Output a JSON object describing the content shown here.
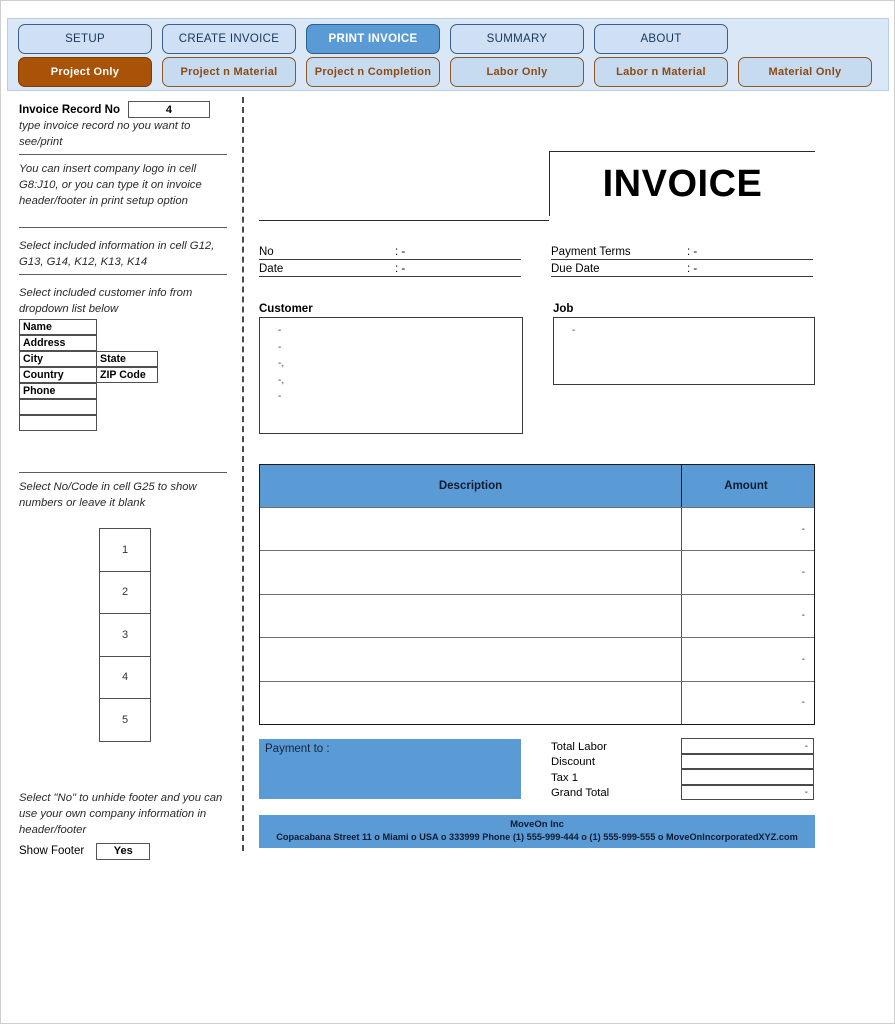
{
  "tabs": {
    "main": [
      {
        "label": "SETUP",
        "active": false
      },
      {
        "label": "CREATE INVOICE",
        "active": false
      },
      {
        "label": "PRINT INVOICE",
        "active": true
      },
      {
        "label": "SUMMARY",
        "active": false
      },
      {
        "label": "ABOUT",
        "active": false
      }
    ],
    "sub": [
      {
        "label": "Project Only",
        "active": true
      },
      {
        "label": "Project n Material",
        "active": false
      },
      {
        "label": "Project n Completion",
        "active": false
      },
      {
        "label": "Labor Only",
        "active": false
      },
      {
        "label": "Labor n Material",
        "active": false
      },
      {
        "label": "Material Only",
        "active": false
      }
    ]
  },
  "sidebar": {
    "record_label": "Invoice Record No",
    "record_value": "4",
    "hint_record": "type invoice record no you want to see/print",
    "hint_logo": "You can insert company logo in cell G8:J10, or you can type it on invoice header/footer in print setup option",
    "hint_info": "Select included information in cell G12, G13, G14, K12, K13, K14",
    "hint_customer": "Select included customer info from dropdown list below",
    "customer_fields": [
      {
        "left": "Name",
        "right": ""
      },
      {
        "left": "Address",
        "right": ""
      },
      {
        "left": "City",
        "right": "State"
      },
      {
        "left": "Country",
        "right": "ZIP Code"
      },
      {
        "left": "Phone",
        "right": ""
      },
      {
        "left": "",
        "right": ""
      },
      {
        "left": "",
        "right": ""
      }
    ],
    "hint_nocode": "Select No/Code in cell G25 to show numbers or leave it blank",
    "numbers": [
      "1",
      "2",
      "3",
      "4",
      "5"
    ],
    "hint_footer": "Select \"No\" to unhide footer and you can use your own company information in header/footer",
    "show_footer_label": "Show Footer",
    "show_footer_value": "Yes"
  },
  "invoice": {
    "title": "INVOICE",
    "meta_left": [
      {
        "key": "No",
        "value": ": -"
      },
      {
        "key": "Date",
        "value": ": -"
      }
    ],
    "meta_right": [
      {
        "key": "Payment  Terms",
        "value": ": -"
      },
      {
        "key": "Due Date",
        "value": ": -"
      }
    ],
    "customer_label": "Customer",
    "customer_lines": [
      "-",
      "-",
      "-,",
      "-,",
      "-"
    ],
    "job_label": "Job",
    "job_lines": [
      "-"
    ],
    "items_headers": {
      "description": "Description",
      "amount": "Amount"
    },
    "items_rows": [
      {
        "description": "",
        "amount": "-"
      },
      {
        "description": "",
        "amount": "-"
      },
      {
        "description": "",
        "amount": "-"
      },
      {
        "description": "",
        "amount": "-"
      },
      {
        "description": "",
        "amount": "-"
      }
    ],
    "payment_to_label": "Payment to :",
    "totals": [
      {
        "key": "Total Labor",
        "value": "-"
      },
      {
        "key": "Discount",
        "value": ""
      },
      {
        "key": "Tax 1",
        "value": ""
      },
      {
        "key": "Grand Total",
        "value": "-"
      }
    ],
    "footer_company": "MoveOn Inc",
    "footer_address": "Copacabana Street 11 o Miami o USA o 333999 Phone (1) 555-999-444 o (1) 555-999-555 o MoveOnIncorporatedXYZ.com"
  },
  "colors": {
    "tab_active_blue": "#5b9bd5",
    "tab_active_orange": "#a85307",
    "tabbar_bg": "#d9e7f7",
    "table_header_blue": "#5b9bd5"
  }
}
